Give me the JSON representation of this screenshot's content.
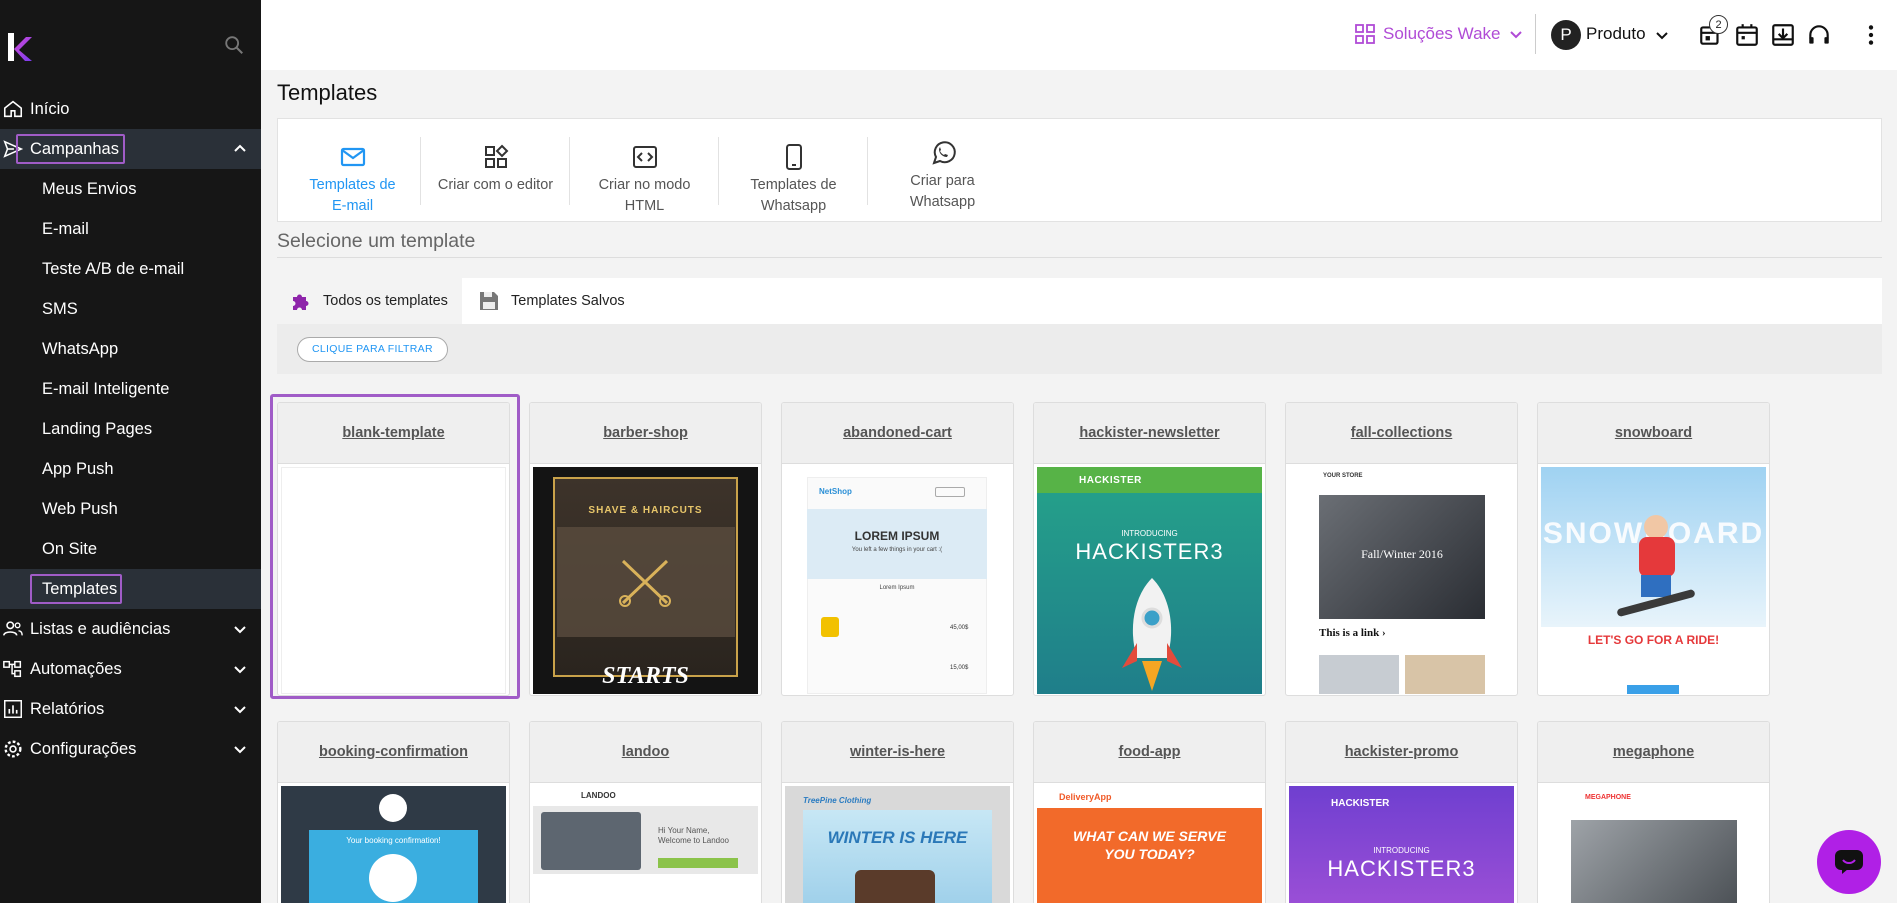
{
  "sidebar": {
    "nav": [
      {
        "label": "Início",
        "icon": "home-icon"
      },
      {
        "label": "Campanhas",
        "icon": "send-icon"
      },
      {
        "label": "Listas e audiências",
        "icon": "people-icon"
      },
      {
        "label": "Automações",
        "icon": "automation-icon"
      },
      {
        "label": "Relatórios",
        "icon": "report-icon"
      },
      {
        "label": "Configurações",
        "icon": "gear-icon"
      }
    ],
    "sub": [
      "Meus Envios",
      "E-mail",
      "Teste A/B de e-mail",
      "SMS",
      "WhatsApp",
      "E-mail Inteligente",
      "Landing Pages",
      "App Push",
      "Web Push",
      "On Site",
      "Templates"
    ]
  },
  "header": {
    "solutions_label": "Soluções Wake",
    "profile_initial": "P",
    "profile_label": "Produto",
    "notification_count": "2"
  },
  "page": {
    "title": "Templates",
    "section_title": "Selecione um template"
  },
  "tools": [
    {
      "line1": "Templates de",
      "line2": "E-mail",
      "icon": "mail-icon"
    },
    {
      "line1": "Criar com o editor",
      "line2": "",
      "icon": "editor-blocks-icon"
    },
    {
      "line1": "Criar no modo",
      "line2": "HTML",
      "icon": "code-icon"
    },
    {
      "line1": "Templates de",
      "line2": "Whatsapp",
      "icon": "phone-icon"
    },
    {
      "line1": "Criar para",
      "line2": "Whatsapp",
      "icon": "whatsapp-icon"
    }
  ],
  "tabs": [
    {
      "label": "Todos os templates",
      "icon": "puzzle-icon"
    },
    {
      "label": "Templates Salvos",
      "icon": "save-icon"
    }
  ],
  "filter_label": "CLIQUE PARA FILTRAR",
  "templates": [
    {
      "name": "blank-template"
    },
    {
      "name": "barber-shop",
      "text1": "SHAVE & HAIRCUTS",
      "text2": "STARTS"
    },
    {
      "name": "abandoned-cart",
      "text1": "NetShop",
      "text2": "LOREM IPSUM",
      "text3": "You left a few things in your cart :(",
      "text4": "Lorem Ipsum",
      "text5": "45,00$",
      "text6": "15,00$"
    },
    {
      "name": "hackister-newsletter",
      "text1": "HACKISTER",
      "text2": "INTRODUCING",
      "text3": "HACKISTER3"
    },
    {
      "name": "fall-collections",
      "text1": "YOUR STORE",
      "text2": "Fall/Winter 2016",
      "text3": "This is a link ›"
    },
    {
      "name": "snowboard",
      "text1": "SNOWBOARD",
      "text2": "LET'S GO FOR A RIDE!"
    },
    {
      "name": "booking-confirmation",
      "text1": "Your booking confirmation!"
    },
    {
      "name": "landoo",
      "text1": "LANDOO",
      "text2": "Hi Your Name,",
      "text3": "Welcome to Landoo"
    },
    {
      "name": "winter-is-here",
      "text1": "TreePine Clothing",
      "text2": "WINTER IS HERE"
    },
    {
      "name": "food-app",
      "text1": "DeliveryApp",
      "text2": "WHAT CAN WE SERVE",
      "text3": "YOU TODAY?"
    },
    {
      "name": "hackister-promo",
      "text1": "HACKISTER",
      "text2": "INTRODUCING",
      "text3": "HACKISTER3"
    },
    {
      "name": "megaphone",
      "text1": "MEGAPHONE"
    }
  ],
  "colors": {
    "accent": "#b04bd6",
    "blue": "#2196f3",
    "sidebar": "#161616",
    "highlight": "#a05cc7"
  }
}
